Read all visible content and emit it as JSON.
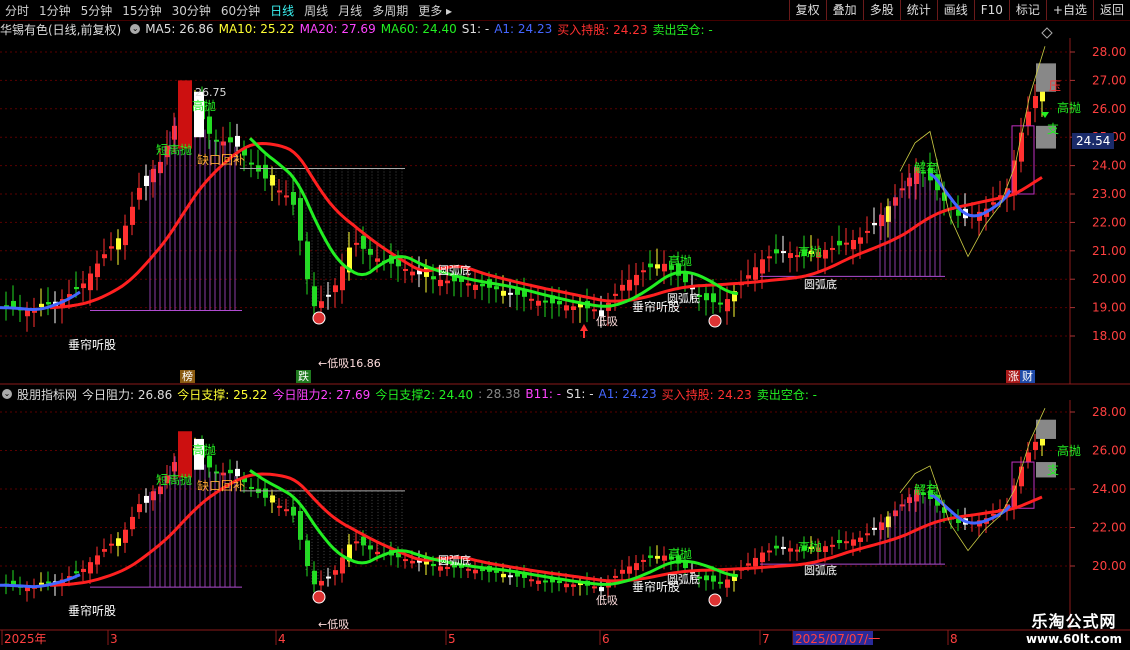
{
  "toolbar": {
    "periods": [
      "分时",
      "1分钟",
      "5分钟",
      "15分钟",
      "30分钟",
      "60分钟",
      "日线",
      "周线",
      "月线",
      "多周期",
      "更多 ▸"
    ],
    "active_index": 6,
    "right_buttons": [
      "复权",
      "叠加",
      "多股",
      "统计",
      "画线",
      "F10",
      "标记",
      "+自选",
      "返回"
    ]
  },
  "top_info": {
    "stock": "华锡有色(日线,前复权)",
    "ma5": "MA5: 26.86",
    "ma10": "MA10: 25.22",
    "ma20": "MA20: 27.69",
    "ma60": "MA60: 24.40",
    "s1": "S1: -",
    "a1": "A1: 24.23",
    "buy": "买入持股: 24.23",
    "sell": "卖出空仓: -"
  },
  "bottom_info": {
    "name": "股朋指标网",
    "r1": "今日阻力: 26.86",
    "s1": "今日支撑: 25.22",
    "r2": "今日阻力2: 27.69",
    "s2": "今日支撑2: 24.40",
    "v": ": 28.38",
    "b11": "B11: -",
    "s1b": "S1: -",
    "a1": "A1: 24.23",
    "buy": "买入持股: 24.23",
    "sell": "卖出空仓: -"
  },
  "colors": {
    "ma_red": "#ff2020",
    "ma_green": "#22ee22",
    "yellow": "#ffff33",
    "magenta": "#ff44ff",
    "cyan": "#33ffff",
    "blue": "#4466ff",
    "grid": "#5a0000",
    "up": "#ff3030",
    "down": "#22dd22"
  },
  "top_axis": [
    "28.00",
    "27.00",
    "26.00",
    "25.00",
    "24.00",
    "23.00",
    "22.00",
    "21.00",
    "20.00",
    "19.00",
    "18.00"
  ],
  "bottom_axis": [
    "28.00",
    "26.00",
    "24.00",
    "22.00",
    "20.00"
  ],
  "current_price": "24.54",
  "date_axis": [
    "2025年",
    "3",
    "4",
    "5",
    "6",
    "7",
    "2025/07/07/一",
    "8"
  ],
  "labels": {
    "high": "26.75",
    "low": "16.86",
    "gaokao_1": "高抛",
    "qiang_1": "短高抛",
    "gap": "缺口回补",
    "yuanhu_1": "圆弧底",
    "yuanhu_2": "圆弧底",
    "yuanhu_3": "圆弧底",
    "listen": "垂帘听股",
    "listen_2": "垂帘听股",
    "listen_3": "垂帘听股",
    "dixi": "低吸",
    "dixi_2": "低吸",
    "gaokao_2": "高抛",
    "gaokao_3": "高抛",
    "jiekai": "解套",
    "gaokao_r": "高抛",
    "zhi": "支",
    "ya": "压"
  },
  "badges": {
    "bang": "榜",
    "die": "跌",
    "zhang": "涨",
    "cai": "财"
  },
  "watermark": {
    "line1": "乐淘公式网",
    "line2": "www.60lt.com"
  }
}
